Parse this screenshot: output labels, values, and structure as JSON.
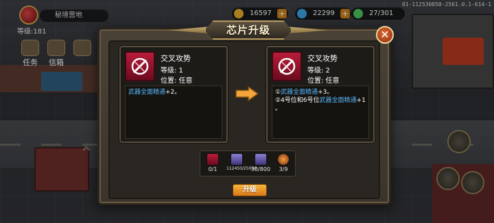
{
  "hud": {
    "player_name": "秘境营地",
    "level": "等级:181",
    "gold": "16597万",
    "gems": "22299",
    "energy": "27/301",
    "build_id": "01-112530850-2561.0.1-614-1"
  },
  "menu": {
    "task": "任务",
    "mail": "信箱"
  },
  "dialog": {
    "title": "芯片升级",
    "close_label": "✕",
    "current": {
      "name": "交叉攻势",
      "level": "等级: 1",
      "position": "位置: 任意",
      "effect_name": "武器全面精通",
      "effect_value": "+2。"
    },
    "next": {
      "name": "交叉攻势",
      "level": "等级: 2",
      "position": "位置: 任意",
      "line1_prefix": "①",
      "line1_name": "武器全面精通",
      "line1_value": "+3。",
      "line2_prefix": "②4号位和6号位",
      "line2_name": "武器全面精通",
      "line2_value": "+1",
      "line2_end": "。"
    },
    "materials": [
      {
        "icon": "chip-icon",
        "count": "0/1"
      },
      {
        "icon": "card-icon",
        "count": "112450/25000"
      },
      {
        "icon": "card-icon",
        "count": "30/800"
      },
      {
        "icon": "orb-icon",
        "count": "3/9"
      }
    ],
    "upgrade_label": "升级"
  },
  "colors": {
    "chip_red": "#b81c3a",
    "highlight_blue": "#57b7ff",
    "button_orange": "#e8921f",
    "arrow_orange": "#f2a53a"
  }
}
